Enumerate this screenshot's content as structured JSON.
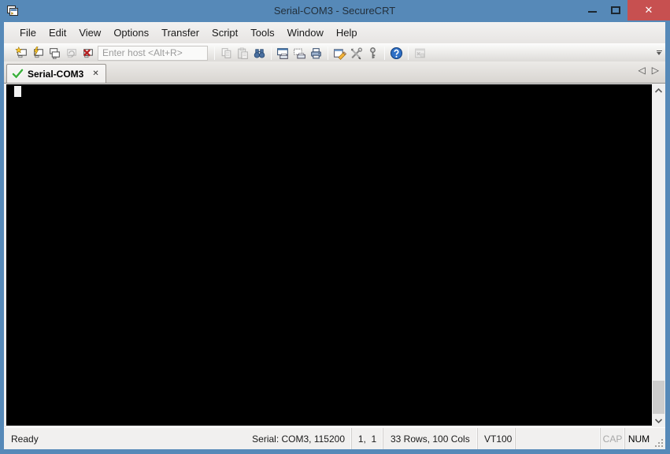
{
  "window": {
    "title": "Serial-COM3 - SecureCRT",
    "close_glyph": "✕"
  },
  "menu": {
    "items": [
      "File",
      "Edit",
      "View",
      "Options",
      "Transfer",
      "Script",
      "Tools",
      "Window",
      "Help"
    ]
  },
  "toolbar": {
    "host_placeholder": "Enter host <Alt+R>",
    "icons": [
      "connect-icon",
      "quick-connect-icon",
      "connect-in-tab-icon",
      "reconnect-icon",
      "disconnect-icon",
      "copy-icon",
      "paste-icon",
      "find-icon",
      "print-screen-icon",
      "print-selection-icon",
      "print-icon",
      "session-options-icon",
      "global-options-icon",
      "key-generator-icon",
      "help-icon",
      "session-manager-icon",
      "toolbar-overflow-icon"
    ]
  },
  "tab_bar": {
    "active_tab": {
      "label": "Serial-COM3",
      "close_glyph": "✕",
      "status_icon": "connected-check-icon"
    },
    "scroll_left_glyph": "◁",
    "scroll_right_glyph": "▷"
  },
  "terminal": {
    "content": "",
    "cursor_visible": true
  },
  "status_bar": {
    "ready": "Ready",
    "connection": "Serial: COM3, 115200",
    "cursor_position": "1,  1",
    "screen_size": "33 Rows, 100 Cols",
    "emulation": "VT100",
    "caps_indicator": "CAP",
    "num_indicator": "NUM"
  },
  "colors": {
    "titlebar": "#5689b8",
    "close_button": "#c75050",
    "terminal_bg": "#000000",
    "terminal_cursor": "#f2f2f2",
    "tab_check_green": "#3db03d",
    "status_bg": "#f1f0ef"
  }
}
